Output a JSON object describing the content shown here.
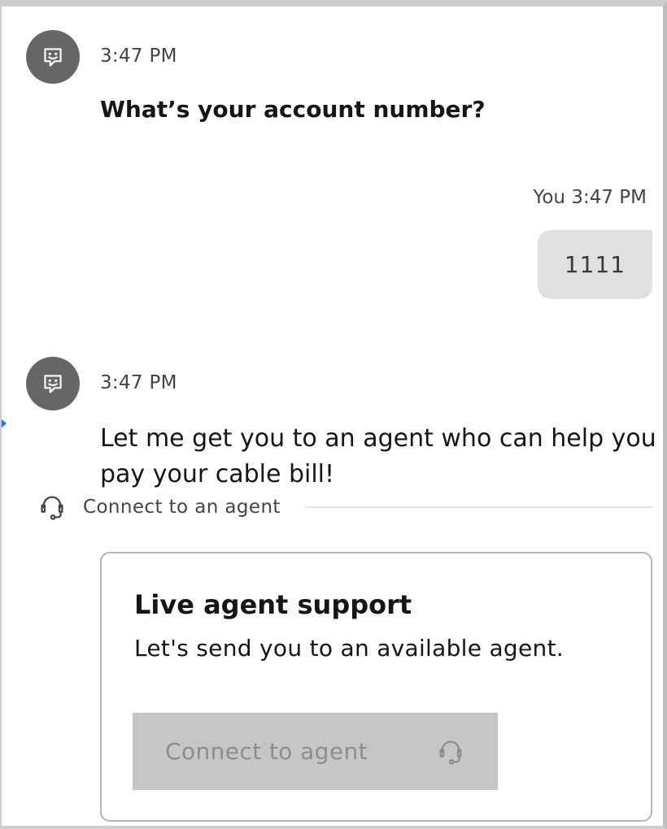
{
  "messages": [
    {
      "sender": "bot",
      "time": "3:47 PM",
      "text": "What’s your account number?"
    },
    {
      "sender": "user",
      "sender_label": "You",
      "time": "3:47 PM",
      "text": "1111"
    },
    {
      "sender": "bot",
      "time": "3:47 PM",
      "text": "Let me get you to an agent who can help you pay your cable bill!"
    }
  ],
  "you_time_label": "You 3:47 PM",
  "agent_divider": {
    "label": "Connect to an agent",
    "icon": "headset-icon"
  },
  "card": {
    "title": "Live agent support",
    "subtitle": "Let's send you to an available agent.",
    "button_label": "Connect to agent",
    "button_icon": "headset-icon",
    "button_state": "disabled"
  },
  "colors": {
    "avatar_bg": "#666666",
    "user_bubble_bg": "#e0e0e0",
    "button_disabled_bg": "#c6c6c6",
    "button_disabled_text": "#8d8d8d"
  }
}
